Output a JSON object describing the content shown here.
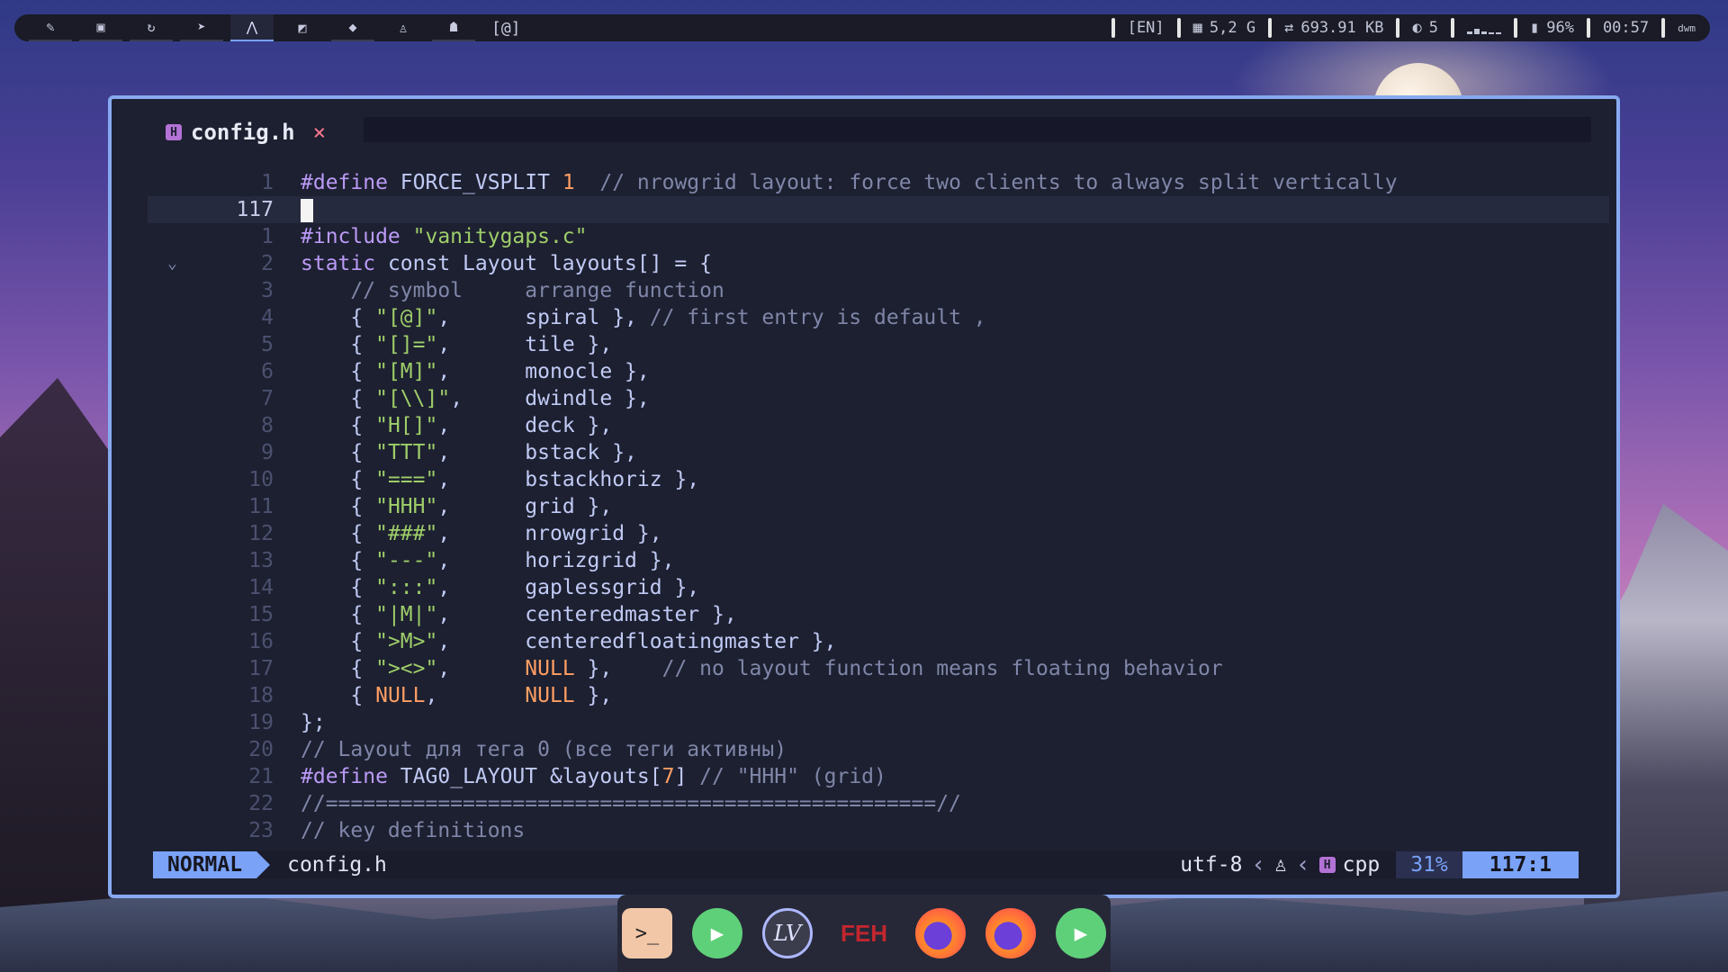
{
  "topbar": {
    "tags": [
      {
        "icon": "brush-icon",
        "glyph": "✎"
      },
      {
        "icon": "terminal-icon",
        "glyph": "▣"
      },
      {
        "icon": "refresh-icon",
        "glyph": "↻"
      },
      {
        "icon": "telegram-icon",
        "glyph": "➤"
      },
      {
        "icon": "arch-icon",
        "glyph": "⋀"
      },
      {
        "icon": "vscode-icon",
        "glyph": "◩"
      },
      {
        "icon": "git-icon",
        "glyph": "◆"
      },
      {
        "icon": "tux-icon",
        "glyph": "♙"
      },
      {
        "icon": "steam-icon",
        "glyph": "☗"
      }
    ],
    "layout_symbol": "[@]",
    "keyboard_layout": "[EN]",
    "memory": "5,2 G",
    "network": "693.91 KB",
    "updates": "5",
    "battery": "96%",
    "clock": "00:57",
    "colors": {
      "accent": "#7aa2f7",
      "background": "#1a1b26"
    }
  },
  "editor": {
    "tab": {
      "filename": "config.h",
      "close_glyph": "×"
    },
    "lines": [
      {
        "num": "1",
        "text": "#define FORCE_VSPLIT 1  // nrowgrid layout: force two clients to always split vertically"
      },
      {
        "num": "117",
        "text": "",
        "current": true
      },
      {
        "num": "1",
        "text": "#include \"vanitygaps.c\""
      },
      {
        "num": "2",
        "text": "static const Layout layouts[] = {",
        "fold": "⌄"
      },
      {
        "num": "3",
        "text": "    // symbol     arrange function"
      },
      {
        "num": "4",
        "text": "    { \"[@]\",      spiral }, // first entry is default ,"
      },
      {
        "num": "5",
        "text": "    { \"[]=\",      tile },"
      },
      {
        "num": "6",
        "text": "    { \"[M]\",      monocle },"
      },
      {
        "num": "7",
        "text": "    { \"[\\\\]\",     dwindle },"
      },
      {
        "num": "8",
        "text": "    { \"H[]\",      deck },"
      },
      {
        "num": "9",
        "text": "    { \"TTT\",      bstack },"
      },
      {
        "num": "10",
        "text": "    { \"===\",      bstackhoriz },"
      },
      {
        "num": "11",
        "text": "    { \"HHH\",      grid },"
      },
      {
        "num": "12",
        "text": "    { \"###\",      nrowgrid },"
      },
      {
        "num": "13",
        "text": "    { \"---\",      horizgrid },"
      },
      {
        "num": "14",
        "text": "    { \":::\",      gaplessgrid },"
      },
      {
        "num": "15",
        "text": "    { \"|M|\",      centeredmaster },"
      },
      {
        "num": "16",
        "text": "    { \">M>\",      centeredfloatingmaster },"
      },
      {
        "num": "17",
        "text": "    { \"><>\",      NULL },    // no layout function means floating behavior"
      },
      {
        "num": "18",
        "text": "    { NULL,       NULL },"
      },
      {
        "num": "19",
        "text": "};"
      },
      {
        "num": "20",
        "text": "// Layout для тега 0 (все теги активны)"
      },
      {
        "num": "21",
        "text": "#define TAG0_LAYOUT &layouts[7] // \"HHH\" (grid)"
      },
      {
        "num": "22",
        "text": "//=================================================//"
      },
      {
        "num": "23",
        "text": "// key definitions"
      }
    ]
  },
  "statusline": {
    "mode": "NORMAL",
    "file": "config.h",
    "encoding": "utf-8",
    "filetype": "cpp",
    "percent": "31%",
    "position": "117:1"
  },
  "dock": {
    "items": [
      {
        "name": "terminal",
        "glyph": ">_"
      },
      {
        "name": "media-player",
        "glyph": "▶"
      },
      {
        "name": "livewire",
        "glyph": "LV"
      },
      {
        "name": "feh",
        "glyph": "FEH"
      },
      {
        "name": "firefox",
        "glyph": ""
      },
      {
        "name": "firefox",
        "glyph": ""
      },
      {
        "name": "media-player",
        "glyph": "▶"
      }
    ]
  }
}
